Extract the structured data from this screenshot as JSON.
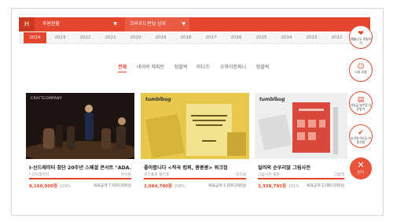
{
  "filters": {
    "home_label": "H",
    "select1": "후원현황",
    "select2": "크라우드펀딩 상위"
  },
  "years": [
    "2024",
    "2023",
    "2022",
    "2021",
    "2020",
    "2019",
    "2018",
    "2017",
    "2016",
    "2015",
    "2014",
    "2013",
    "2012",
    "2011"
  ],
  "tabs": [
    "전체",
    "네이버 해피빈",
    "텀블벅",
    "와디즈",
    "오마이컴퍼니",
    "텀블벅"
  ],
  "cards": [
    {
      "logo": "CRAFTCOMPANY",
      "title": "I-신드레이터 창단 20주년 스페셜 콘서트 \"ADA...",
      "sub": "I-신드레이터",
      "category": "콘서트",
      "amount": "8,160,000원",
      "percent": "116%",
      "percent_value": 116,
      "goal": "목표금액 7,000,000원"
    },
    {
      "logo": "tumblbug",
      "title": "좋아합니다 <작곡 컴퍼, 콩콩콩> 워크집",
      "sub": "워크플로 멀티포",
      "category": "워크북",
      "amount": "2,084,700원",
      "percent": "208%",
      "percent_value": 208,
      "goal": "목표금액 1,000,000원"
    },
    {
      "logo": "tumblbug",
      "title": "일러의 순우리말 그림사전",
      "sub": "그림사전 출판",
      "category": "그림책",
      "amount": "3,338,795원",
      "percent": "151%",
      "percent_value": 151,
      "goal": "목표금액 2,080,000원"
    }
  ],
  "side_buttons": [
    {
      "icon": "heart-hands-icon",
      "label": "예술나무 후원하기"
    },
    {
      "icon": "person-icon",
      "label": "나의 후원"
    },
    {
      "icon": "document-icon",
      "label": "기부금 영수증 다운받기"
    },
    {
      "icon": "checklist-icon",
      "label": "조건부기부금 지원신청"
    }
  ],
  "close_button": {
    "label": "닫기"
  },
  "accent_color": "#e4472d"
}
